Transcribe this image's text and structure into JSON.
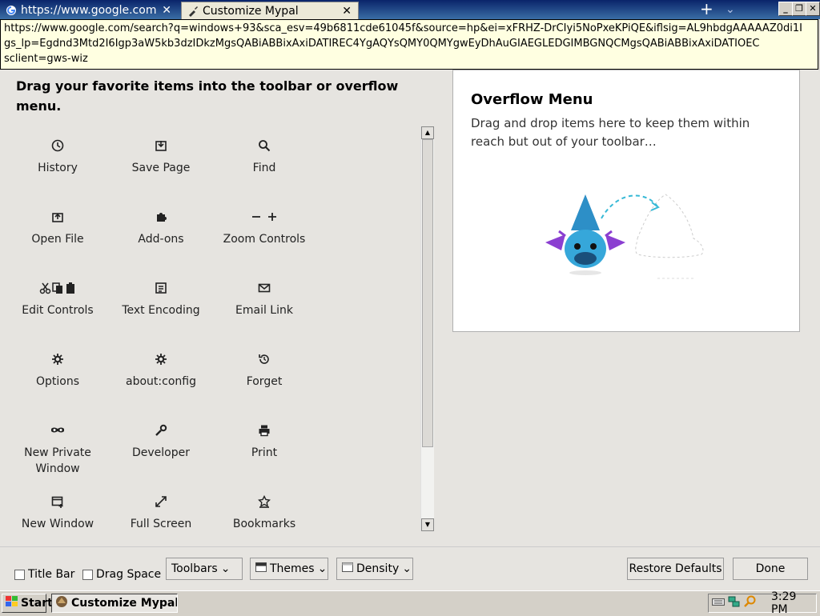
{
  "tabs": [
    {
      "title": "https://www.google.com"
    },
    {
      "title": "Customize Mypal"
    }
  ],
  "tooltip": {
    "lines": [
      "https://www.google.com/search?q=windows+93&sca_esv=49b6811cde61045f&source=hp&ei=xFRHZ-DrCIyi5NoPxeKPiQE&iflsig=AL9hbdgAAAAAZ0di1I",
      "gs_lp=Egdnd3Mtd2I6Igp3aW5kb3dzIDkzMgsQABiABBixAxiDATIREC4YgAQYsQMY0QMYgwEyDhAuGIAEGLEDGIMBGNQCMgsQABiABBixAxiDATIOEC",
      "sclient=gws-wiz"
    ]
  },
  "palette": {
    "heading": "Drag your favorite items into the toolbar or overflow menu.",
    "items": [
      {
        "label": "History",
        "icon": "history-icon"
      },
      {
        "label": "Save Page",
        "icon": "save-page-icon"
      },
      {
        "label": "Find",
        "icon": "search-icon"
      },
      {
        "label": "Open File",
        "icon": "open-file-icon"
      },
      {
        "label": "Add-ons",
        "icon": "puzzle-icon"
      },
      {
        "label": "Zoom Controls",
        "icon": "zoom-icon"
      },
      {
        "label": "Edit Controls",
        "icon": "edit-controls-icon"
      },
      {
        "label": "Text Encoding",
        "icon": "text-encoding-icon"
      },
      {
        "label": "Email Link",
        "icon": "envelope-icon"
      },
      {
        "label": "Options",
        "icon": "gear-icon"
      },
      {
        "label": "about:config",
        "icon": "gear-icon"
      },
      {
        "label": "Forget",
        "icon": "forget-icon"
      },
      {
        "label": "New Private Window",
        "icon": "mask-icon"
      },
      {
        "label": "Developer",
        "icon": "wrench-icon"
      },
      {
        "label": "Print",
        "icon": "printer-icon"
      },
      {
        "label": "New Window",
        "icon": "new-window-icon"
      },
      {
        "label": "Full Screen",
        "icon": "fullscreen-icon"
      },
      {
        "label": "Bookmarks",
        "icon": "bookmarks-icon"
      }
    ]
  },
  "overflow": {
    "title": "Overflow Menu",
    "description": "Drag and drop items here to keep them within reach but out of your toolbar…"
  },
  "footer": {
    "title_bar": "Title Bar",
    "drag_space": "Drag Space",
    "toolbars": "Toolbars",
    "themes": "Themes",
    "density": "Density",
    "restore_defaults": "Restore Defaults",
    "done": "Done"
  },
  "taskbar": {
    "start": "Start",
    "task_item": "Customize Mypal...",
    "clock": "3:29 PM"
  }
}
